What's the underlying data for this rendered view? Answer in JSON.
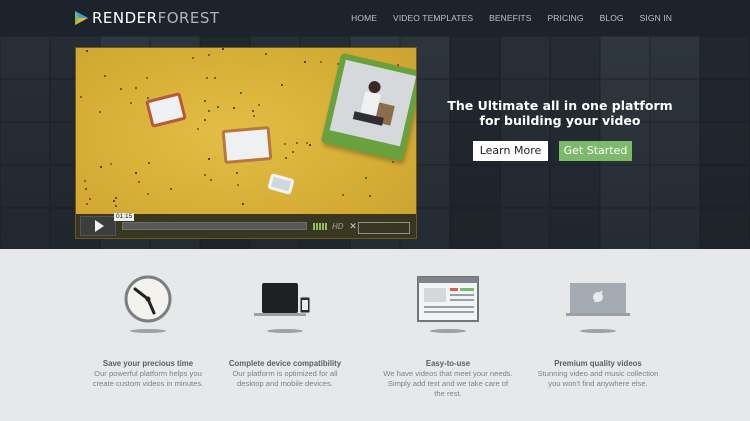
{
  "brand": {
    "part1": "RENDER",
    "part2": "FOREST"
  },
  "nav": [
    {
      "label": "HOME"
    },
    {
      "label": "VIDEO TEMPLATES"
    },
    {
      "label": "BENEFITS"
    },
    {
      "label": "PRICING"
    },
    {
      "label": "BLOG"
    },
    {
      "label": "SIGN IN"
    }
  ],
  "hero": {
    "headline_line1": "The Ultimate all in one platform",
    "headline_line2": "for building your video",
    "learn_more": "Learn More",
    "get_started": "Get Started"
  },
  "video": {
    "time": "01:15",
    "hd": "HD",
    "progress": 0.0
  },
  "features": [
    {
      "icon": "clock-icon",
      "title": "Save your precious time",
      "desc1": "Our powerful platform helps you",
      "desc2": "create custom videos in minutes.",
      "desc3": ""
    },
    {
      "icon": "devices-icon",
      "title": "Complete device compatibility",
      "desc1": "Our platform is optimized for all",
      "desc2": "desktop and mobile devices.",
      "desc3": ""
    },
    {
      "icon": "browser-window-icon",
      "title": "Easy-to-use",
      "desc1": "We have videos that meet your needs.",
      "desc2": "Simply add text and we take care of",
      "desc3": "the rest."
    },
    {
      "icon": "monitor-icon",
      "title": "Premium quality videos",
      "desc1": "Stunning video and music collection",
      "desc2": "you won't find anywhere else.",
      "desc3": ""
    }
  ],
  "colors": {
    "accent_green": "#7cb96a",
    "nav_bg": "#1d232a",
    "video_yellow": "#d9b33b"
  }
}
